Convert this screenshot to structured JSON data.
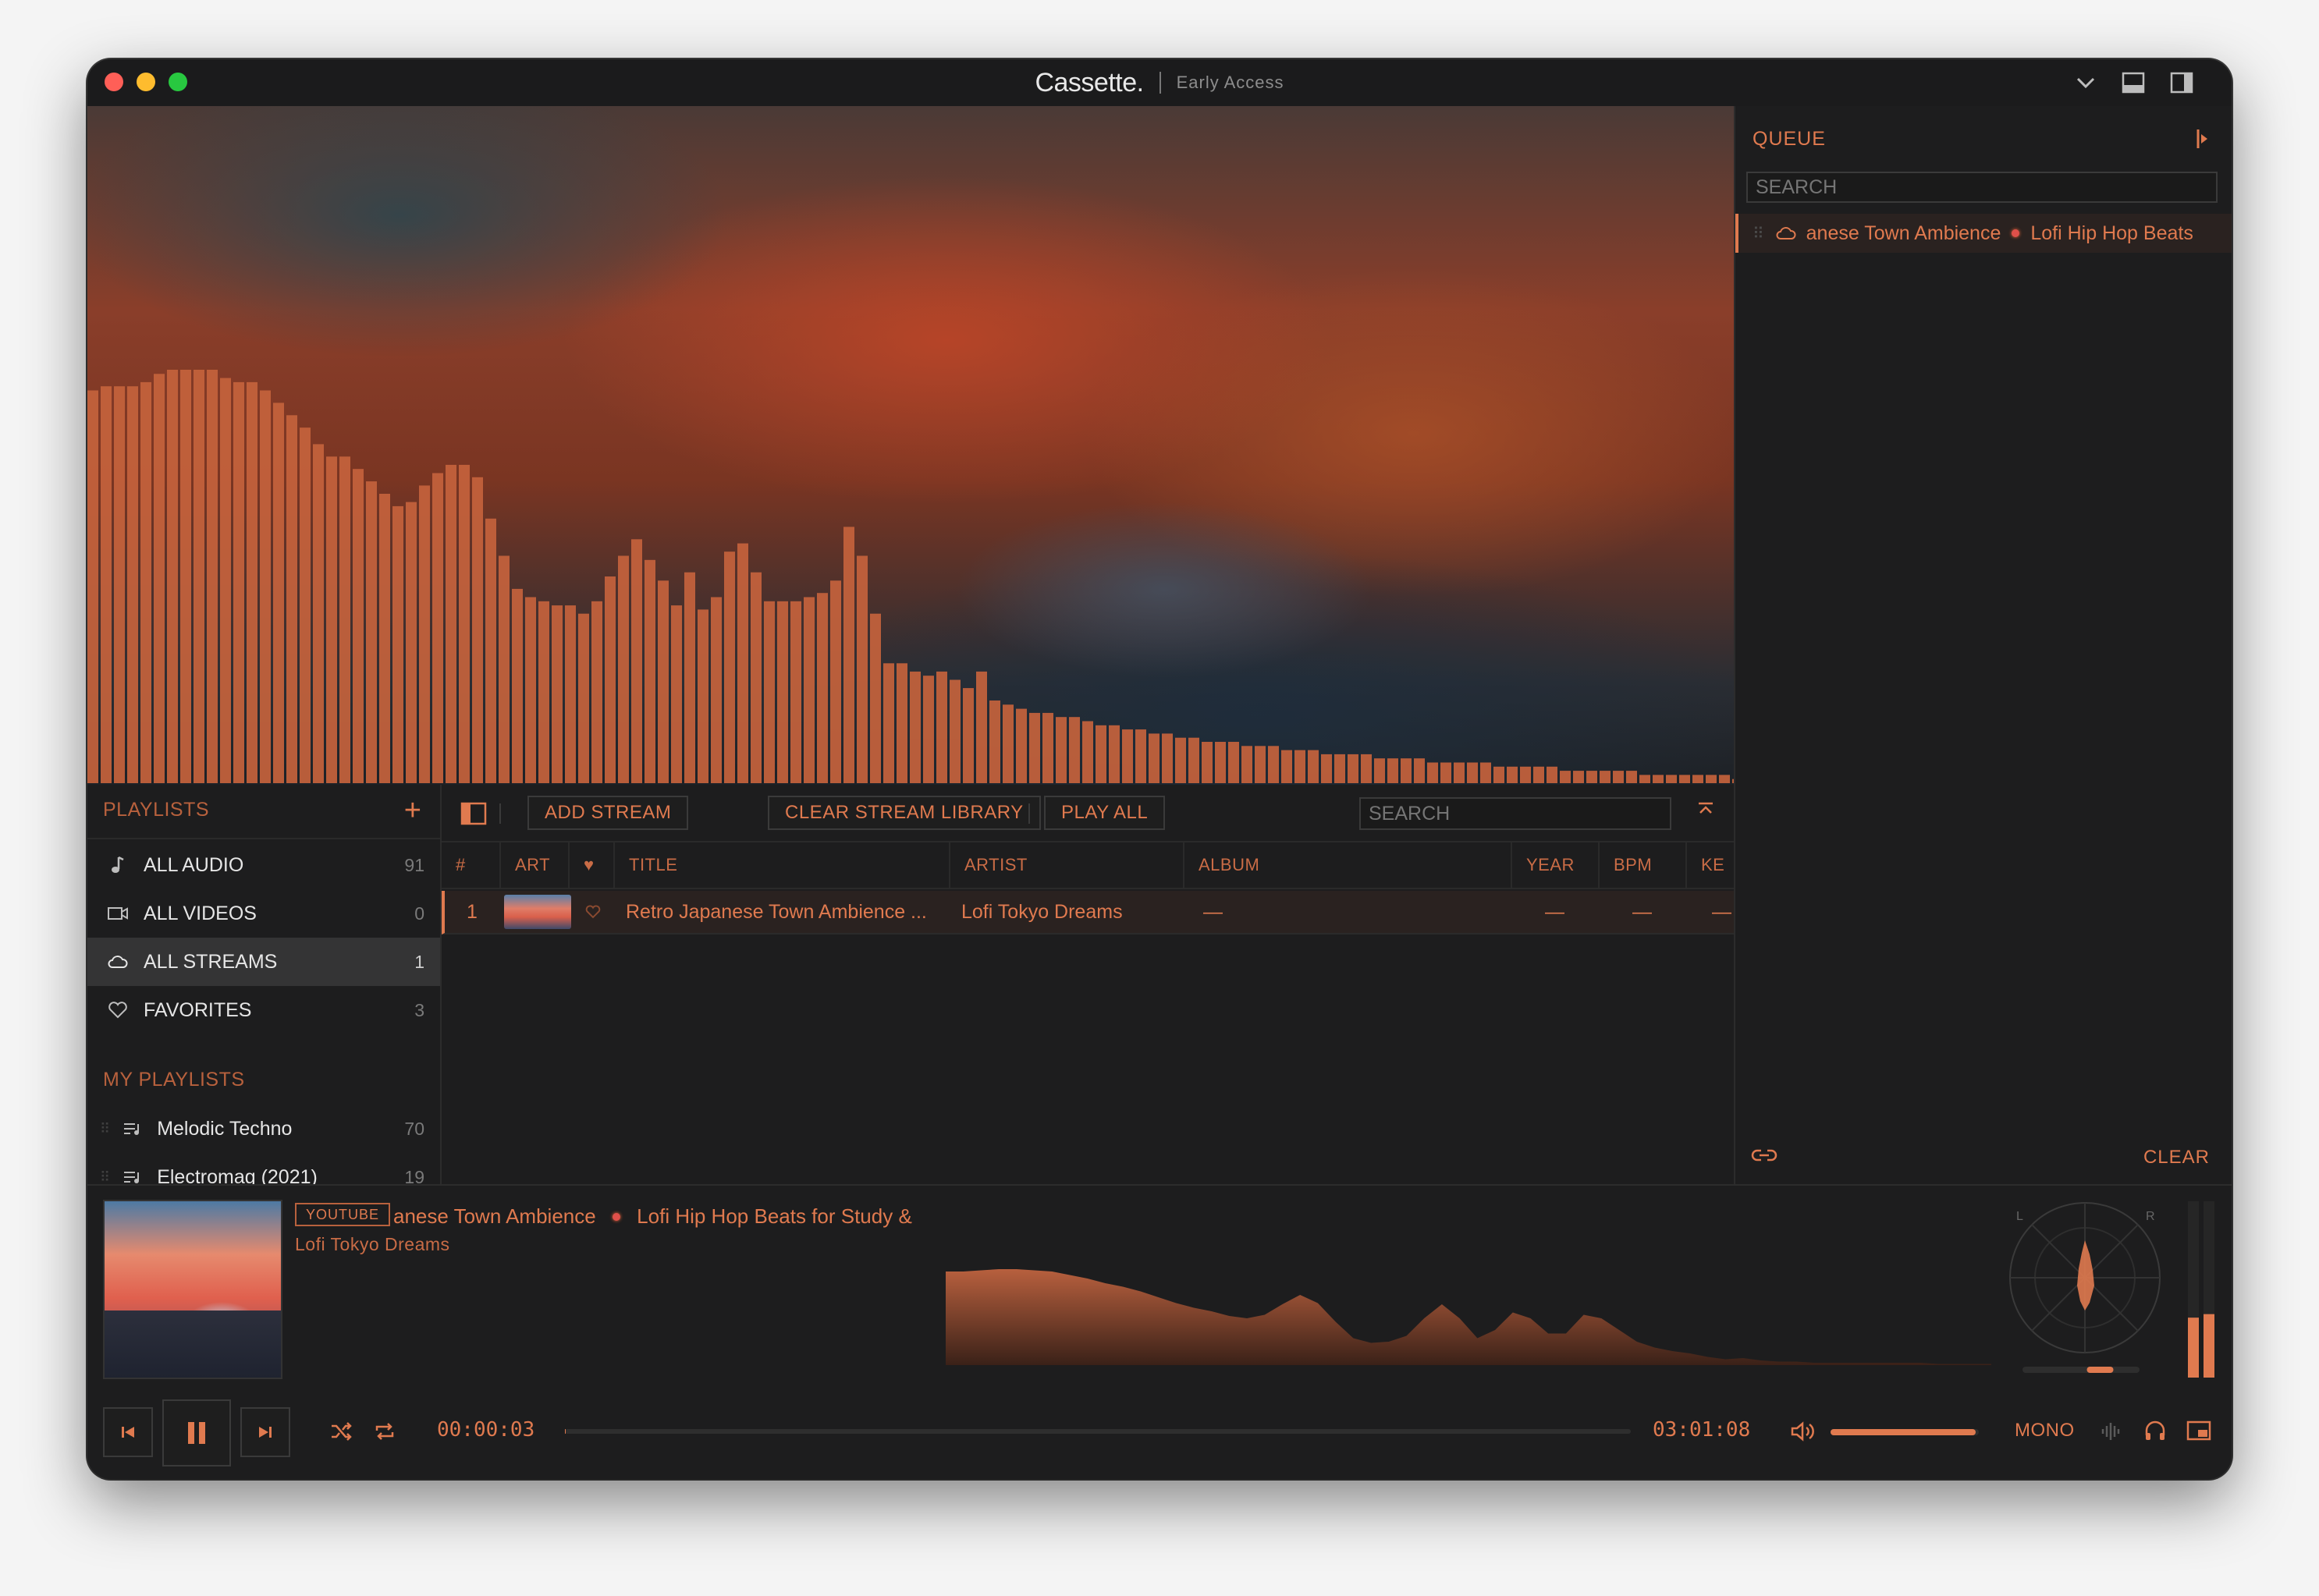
{
  "app": {
    "title": "Cassette.",
    "subtitle": "Early Access"
  },
  "colors": {
    "accent": "#e07a4f",
    "background": "#1d1d1e",
    "row_highlight": "#2a2220"
  },
  "icons": [
    "dropdown-chevron-icon",
    "bottom-panel-icon",
    "side-panel-icon"
  ],
  "visualizer": {
    "levels": [
      0.95,
      0.96,
      0.96,
      0.96,
      0.97,
      0.99,
      1.0,
      1.0,
      1.0,
      1.0,
      0.98,
      0.97,
      0.97,
      0.95,
      0.92,
      0.89,
      0.86,
      0.82,
      0.79,
      0.79,
      0.76,
      0.73,
      0.7,
      0.67,
      0.68,
      0.72,
      0.75,
      0.77,
      0.77,
      0.74,
      0.64,
      0.55,
      0.47,
      0.45,
      0.44,
      0.43,
      0.43,
      0.41,
      0.44,
      0.5,
      0.55,
      0.59,
      0.54,
      0.49,
      0.43,
      0.51,
      0.42,
      0.45,
      0.56,
      0.58,
      0.51,
      0.44,
      0.44,
      0.44,
      0.45,
      0.46,
      0.49,
      0.62,
      0.55,
      0.41,
      0.29,
      0.29,
      0.27,
      0.26,
      0.27,
      0.25,
      0.23,
      0.27,
      0.2,
      0.19,
      0.18,
      0.17,
      0.17,
      0.16,
      0.16,
      0.15,
      0.14,
      0.14,
      0.13,
      0.13,
      0.12,
      0.12,
      0.11,
      0.11,
      0.1,
      0.1,
      0.1,
      0.09,
      0.09,
      0.09,
      0.08,
      0.08,
      0.08,
      0.07,
      0.07,
      0.07,
      0.07,
      0.06,
      0.06,
      0.06,
      0.06,
      0.05,
      0.05,
      0.05,
      0.05,
      0.05,
      0.04,
      0.04,
      0.04,
      0.04,
      0.04,
      0.03,
      0.03,
      0.03,
      0.03,
      0.03,
      0.03,
      0.02,
      0.02,
      0.02,
      0.02,
      0.02,
      0.02,
      0.02,
      0.01,
      0.01,
      0.01,
      0.01,
      0.01,
      0.01,
      0.01,
      0.01,
      0.01,
      0.01,
      0.01,
      0.01,
      0.01,
      0.01,
      0.01
    ]
  },
  "queue": {
    "title": "QUEUE",
    "search_placeholder": "SEARCH",
    "items": [
      {
        "title_part": "anese Town Ambience",
        "artist_part": "Lofi Hip Hop Beats"
      }
    ],
    "clear_label": "CLEAR"
  },
  "sidebar": {
    "header": "PLAYLISTS",
    "add_label": "+",
    "library_items": [
      {
        "label": "ALL AUDIO",
        "count": "91"
      },
      {
        "label": "ALL VIDEOS",
        "count": "0"
      },
      {
        "label": "ALL STREAMS",
        "count": "1"
      },
      {
        "label": "FAVORITES",
        "count": "3"
      }
    ],
    "my_playlists_header": "MY PLAYLISTS",
    "playlists": [
      {
        "label": "Melodic Techno",
        "count": "70"
      },
      {
        "label": "Electromag (2021)",
        "count": "19"
      }
    ]
  },
  "library": {
    "buttons": {
      "add_stream": "ADD STREAM",
      "clear_library": "CLEAR STREAM LIBRARY",
      "play_all": "PLAY ALL"
    },
    "search_placeholder": "SEARCH",
    "columns": {
      "num": "#",
      "art": "ART",
      "fav": "♥",
      "title": "TITLE",
      "artist": "ARTIST",
      "album": "ALBUM",
      "year": "YEAR",
      "bpm": "BPM",
      "key": "KE"
    },
    "rows": [
      {
        "num": "1",
        "title": "Retro Japanese Town Ambience ...",
        "artist": "Lofi Tokyo Dreams",
        "album": "—",
        "year": "—",
        "bpm": "—",
        "key": "—"
      }
    ]
  },
  "player": {
    "source_badge": "YOUTUBE",
    "title_part": "anese Town Ambience",
    "title_part2": "Lofi Hip Hop Beats for Study &",
    "artist": "Lofi Tokyo Dreams",
    "elapsed": "00:00:03",
    "duration": "03:01:08",
    "progress": 0.0003,
    "volume": 0.98,
    "mono_label": "MONO",
    "scope_l": "L",
    "scope_r": "R",
    "meter_left": 0.34,
    "meter_right": 0.36,
    "balance": 0.55,
    "waveform": [
      0.8,
      0.8,
      0.81,
      0.82,
      0.82,
      0.81,
      0.8,
      0.77,
      0.74,
      0.7,
      0.67,
      0.63,
      0.58,
      0.53,
      0.49,
      0.46,
      0.42,
      0.4,
      0.43,
      0.52,
      0.6,
      0.53,
      0.37,
      0.23,
      0.19,
      0.2,
      0.25,
      0.4,
      0.52,
      0.4,
      0.23,
      0.3,
      0.45,
      0.4,
      0.27,
      0.27,
      0.43,
      0.4,
      0.3,
      0.2,
      0.15,
      0.12,
      0.1,
      0.07,
      0.05,
      0.06,
      0.04,
      0.03,
      0.03,
      0.02,
      0.02,
      0.02,
      0.02,
      0.02,
      0.02,
      0.02,
      0.01,
      0.01,
      0.01,
      0.01
    ]
  }
}
